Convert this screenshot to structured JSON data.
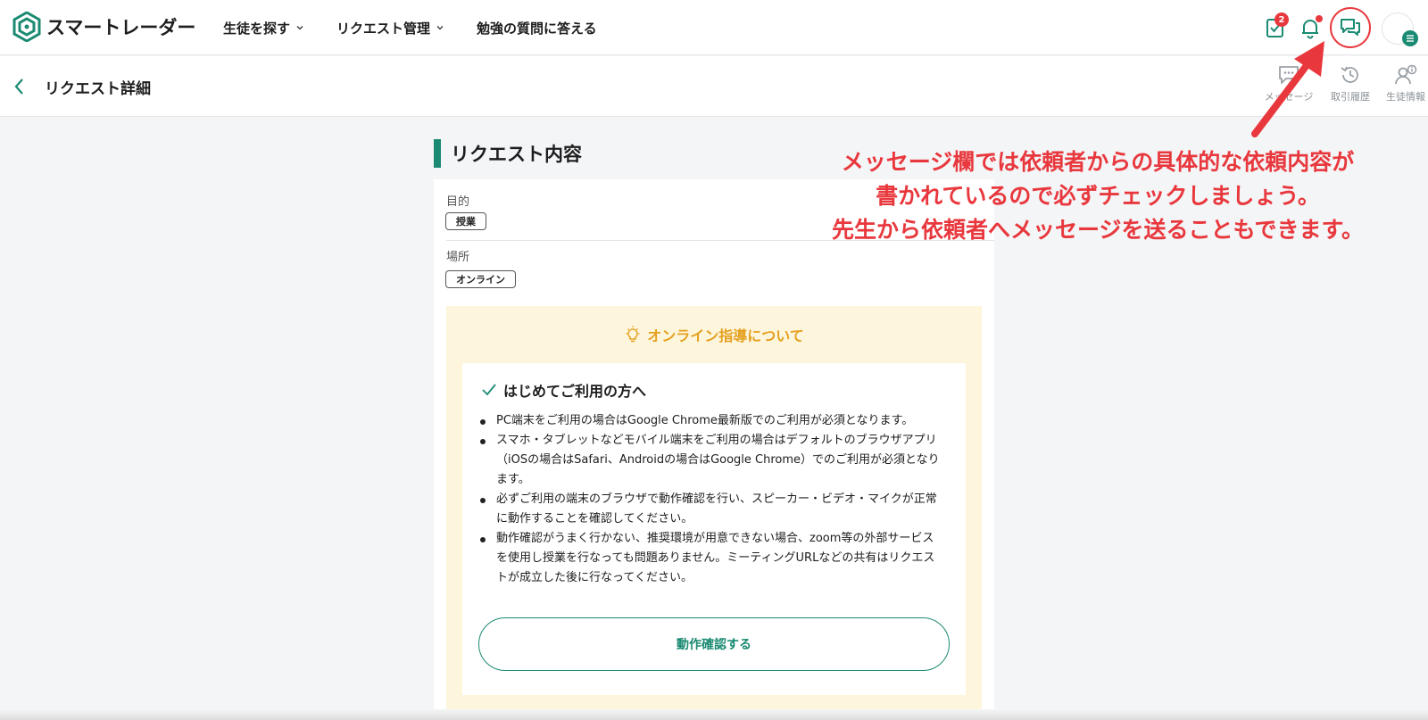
{
  "header": {
    "app_name": "スマートレーダー",
    "nav": [
      {
        "label": "生徒を探す"
      },
      {
        "label": "リクエスト管理"
      },
      {
        "label": "勉強の質問に答える"
      }
    ],
    "task_badge": "2"
  },
  "subheader": {
    "title": "リクエスト詳細",
    "tools": [
      {
        "label": "メッセージ"
      },
      {
        "label": "取引履歴"
      },
      {
        "label": "生徒情報"
      }
    ]
  },
  "request": {
    "section_title": "リクエスト内容",
    "purpose_label": "目的",
    "purpose_value": "授業",
    "location_label": "場所",
    "location_value": "オンライン",
    "online_title": "オンライン指導について",
    "first_time_title": "はじめてご利用の方へ",
    "bullets": [
      "PC端末をご利用の場合はGoogle Chrome最新版でのご利用が必須となります。",
      "スマホ・タブレットなどモバイル端末をご利用の場合はデフォルトのブラウザアプリ（iOSの場合はSafari、Androidの場合はGoogle Chrome）でのご利用が必須となります。",
      "必ずご利用の端末のブラウザで動作確認を行い、スピーカー・ビデオ・マイクが正常に動作することを確認してください。",
      "動作確認がうまく行かない、推奨環境が用意できない場合、zoom等の外部サービスを使用し授業を行なっても問題ありません。ミーティングURLなどの共有はリクエストが成立した後に行なってください。"
    ],
    "check_button": "動作確認する"
  },
  "annotation": {
    "line1": "メッセージ欄では依頼者からの具体的な依頼内容が",
    "line2": "書かれているので必ずチェックしましょう。",
    "line3": "先生から依頼者へメッセージを送ることもできます。"
  },
  "colors": {
    "brand": "#1b8a72",
    "accent_orange": "#e5a01f",
    "annotation_red": "#e8383d",
    "info_bg": "#fdf6dc"
  }
}
